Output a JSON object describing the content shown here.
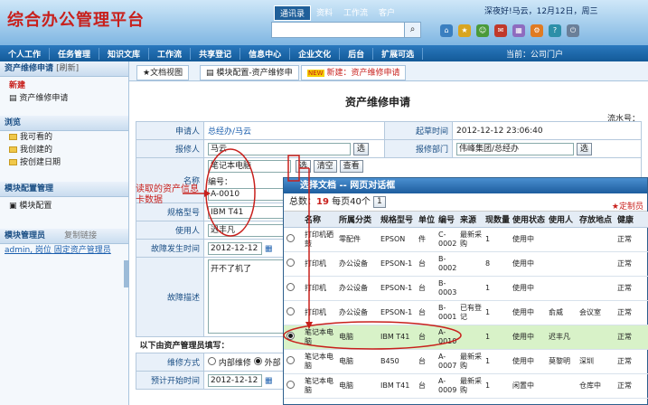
{
  "app": {
    "logo": "综合办公管理平台",
    "greeting": "深夜好!马云，12月12日，周三",
    "top_tabs": [
      "通讯录",
      "资料",
      "工作流",
      "客户"
    ],
    "current_portal": "当前：公司门户"
  },
  "nav": [
    "个人工作",
    "任务管理",
    "知识文库",
    "工作流",
    "共享登记",
    "信息中心",
    "企业文化",
    "后台",
    "扩展可选"
  ],
  "sidebar": {
    "title": "资产维修申请",
    "refresh": "[刷新]",
    "new_label": "新建",
    "new_item": "资产维修申请",
    "browse_label": "浏览",
    "browse_items": [
      "我可看的",
      "我创建的",
      "按创建日期"
    ],
    "module_label": "模块配置管理",
    "module_item": "模块配置",
    "admin_label": "模块管理员",
    "copy_link": "复制链接",
    "admin_info": "admin, 岗位 固定资产管理员"
  },
  "crumbs": {
    "tab1": "★文档视图",
    "tab2": "模块配置-资产维修申",
    "tab3": "新建：资产维修申请",
    "new_badge": "NEW"
  },
  "form": {
    "title": "资产维修申请",
    "flow_no": "流水号：",
    "applicant_label": "申请人",
    "applicant": "总经办/马云",
    "time_label": "起草时间",
    "time": "2012-12-12 23:06:40",
    "reporter_label": "报修人",
    "reporter": "马云",
    "select": "选",
    "dept_label": "报修部门",
    "dept": "伟峰集团/总经办",
    "name_label": "名称",
    "name_value": "笔记本电脑",
    "code_prefix": "编号：",
    "code_value": "A-0010",
    "btn_select": "选",
    "btn_clear": "清空",
    "btn_view": "查看",
    "model_label": "规格型号",
    "model_value": "IBM T41",
    "user_label": "使用人",
    "user_value": "迟丰凡",
    "fault_time_label": "故障发生时间",
    "fault_time": "2012-12-12",
    "fault_desc_label": "故障描述",
    "fault_desc": "开不了机了",
    "admin_section": "以下由资产管理员填写：",
    "repair_mode_label": "维修方式",
    "repair_inner": "内部维修",
    "repair_outer": "外部",
    "start_label": "预计开始时间",
    "start_value": "2012-12-12"
  },
  "annotation": "读取的资产信息卡数据",
  "dialog": {
    "title": "选择文档 -- 网页对话框",
    "summary_prefix": "总数：",
    "count": "19",
    "per_page_text": "每页40个",
    "page_num": "1",
    "custom": "★定制员",
    "headers": [
      "名称",
      "所属分类",
      "规格型号",
      "单位",
      "编号",
      "来源",
      "现数量",
      "使用状态",
      "使用人",
      "存放地点",
      "健康"
    ],
    "rows": [
      {
        "name": "打印机硒鼓",
        "cat": "零配件",
        "model": "EPSON",
        "unit": "件",
        "code": "C-0002",
        "src": "最新采购",
        "qty": "1",
        "status": "使用中",
        "user": "",
        "loc": "",
        "health": "正常",
        "selected": false
      },
      {
        "name": "打印机",
        "cat": "办公设备",
        "model": "EPSON-1",
        "unit": "台",
        "code": "B-0002",
        "src": "",
        "qty": "8",
        "status": "使用中",
        "user": "",
        "loc": "",
        "health": "正常",
        "selected": false
      },
      {
        "name": "打印机",
        "cat": "办公设备",
        "model": "EPSON-1",
        "unit": "台",
        "code": "B-0003",
        "src": "",
        "qty": "1",
        "status": "使用中",
        "user": "",
        "loc": "",
        "health": "正常",
        "selected": false
      },
      {
        "name": "打印机",
        "cat": "办公设备",
        "model": "EPSON-1",
        "unit": "台",
        "code": "B-0001",
        "src": "已有登记",
        "qty": "1",
        "status": "使用中",
        "user": "俞威",
        "loc": "会议室",
        "health": "正常",
        "selected": false
      },
      {
        "name": "笔记本电脑",
        "cat": "电脑",
        "model": "IBM T41",
        "unit": "台",
        "code": "A-0010",
        "src": "",
        "qty": "1",
        "status": "使用中",
        "user": "迟丰凡",
        "loc": "",
        "health": "正常",
        "selected": true
      },
      {
        "name": "笔记本电脑",
        "cat": "电脑",
        "model": "B450",
        "unit": "台",
        "code": "A-0007",
        "src": "最新采购",
        "qty": "1",
        "status": "使用中",
        "user": "莫黎明",
        "loc": "深圳",
        "health": "正常",
        "selected": false
      },
      {
        "name": "笔记本电脑",
        "cat": "电脑",
        "model": "IBM T41",
        "unit": "台",
        "code": "A-0009",
        "src": "最新采购",
        "qty": "1",
        "status": "闲置中",
        "user": "",
        "loc": "仓库中",
        "health": "正常",
        "selected": false
      }
    ]
  }
}
